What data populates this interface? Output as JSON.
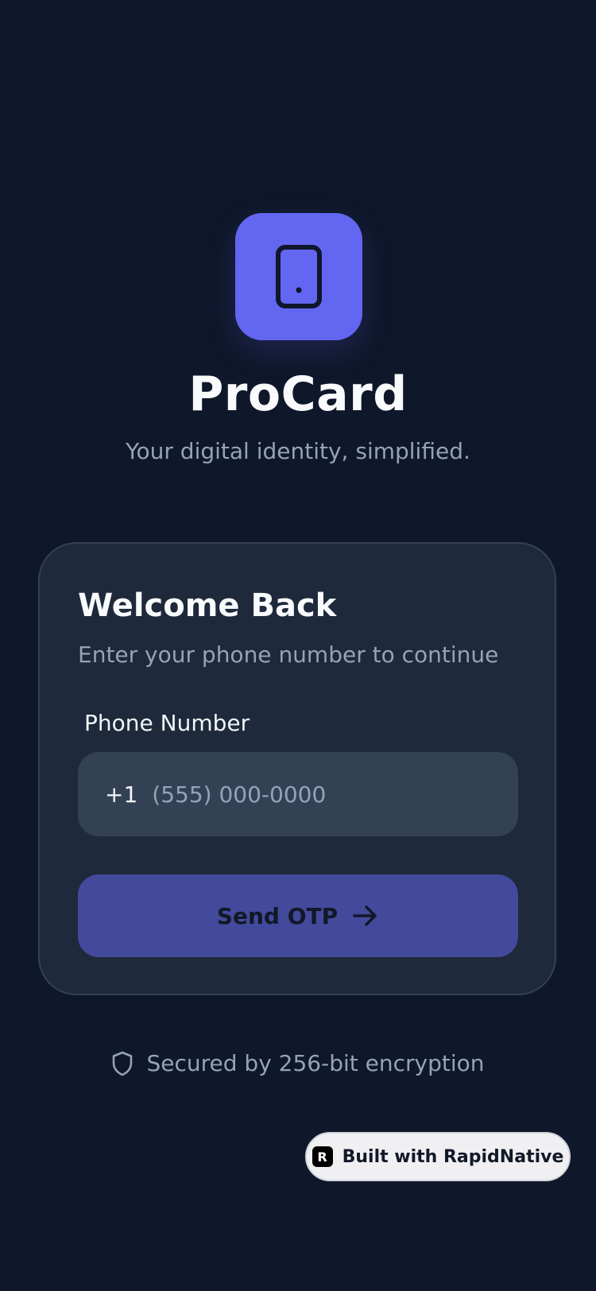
{
  "app": {
    "name": "ProCard",
    "tagline": "Your digital identity, simplified.",
    "logo_icon": "smartphone-icon",
    "brand_color": "#6366f1",
    "background_color": "#0f172a"
  },
  "card": {
    "title": "Welcome Back",
    "subtitle": "Enter your phone number to continue",
    "phone_label": "Phone Number",
    "country_code": "+1",
    "phone_placeholder": "(555) 000-0000",
    "phone_value": "",
    "send_button_label": "Send OTP",
    "send_button_icon": "arrow-right-icon",
    "send_button_color": "#434a9c"
  },
  "security": {
    "icon": "shield-icon",
    "text": "Secured by 256-bit encryption"
  },
  "badge": {
    "logo_letter": "R",
    "text": "Built with RapidNative"
  }
}
